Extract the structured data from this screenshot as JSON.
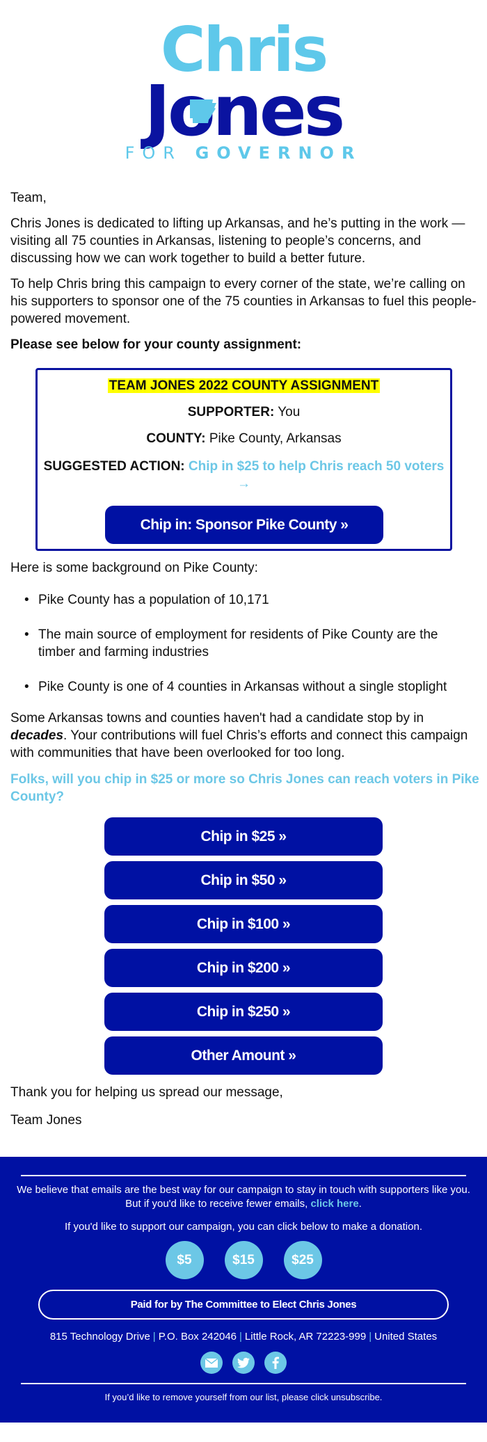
{
  "logo": {
    "first_name": "Chris",
    "last_name": "Jones",
    "tagline_light": "FOR ",
    "tagline_bold": "GOVERNOR",
    "icon": "arkansas-state-shape"
  },
  "body": {
    "greeting": "Team,",
    "paragraph1": "Chris Jones is dedicated to lifting up Arkansas, and he’s putting in the work — visiting all 75 counties in Arkansas, listening to people’s concerns, and discussing how we can work together to build a better future.",
    "paragraph2": "To help Chris bring this campaign to every corner of the state, we’re calling on his supporters to sponsor one of the 75 counties in Arkansas to fuel this people-powered movement.",
    "assignment_intro": "Please see below for your county assignment:"
  },
  "assignment": {
    "title": "TEAM JONES 2022 COUNTY ASSIGNMENT",
    "supporter_label": "SUPPORTER:",
    "supporter_value": " You",
    "county_label": "COUNTY:",
    "county_value": " Pike County, Arkansas",
    "action_label": "SUGGESTED ACTION:",
    "action_link": "Chip in $25 to help Chris reach 50 voters",
    "action_arrow": "→",
    "button_label": "Chip in: Sponsor Pike County »"
  },
  "background": {
    "intro": "Here is some background on Pike County:",
    "facts": [
      "Pike County has a population of 10,171",
      "The main source of employment for residents of Pike County are the timber and farming industries",
      "Pike County is one of 4 counties in Arkansas without a single stoplight"
    ]
  },
  "appeal": {
    "text_before": "Some Arkansas towns and counties haven't had a candidate stop by in ",
    "emphasis": "decades",
    "text_after": ". Your contributions will fuel Chris’s efforts and connect this campaign with communities that have been overlooked for too long.",
    "ask": "Folks, will you chip in $25 or more so Chris Jones can reach voters in Pike County?"
  },
  "donate_buttons": [
    "Chip in $25 »",
    "Chip in $50 »",
    "Chip in $100 »",
    "Chip in $200 »",
    "Chip in $250 »",
    "Other Amount »"
  ],
  "closing": {
    "thanks": "Thank you for helping us spread our message,",
    "signature": "Team Jones"
  },
  "footer": {
    "email_pref_text": "We believe that emails are the best way for our campaign to stay in touch with supporters like you. But if you'd like to receive fewer emails, ",
    "email_pref_link": "click here",
    "email_pref_end": ".",
    "donate_text": "If you'd like to support our campaign, you can click below to make a donation.",
    "quick_amounts": [
      "$5",
      "$15",
      "$25"
    ],
    "paid_for": "Paid for by The Committee to Elect Chris Jones",
    "address_parts": [
      "815 Technology Drive",
      "P.O. Box 242046",
      "Little Rock, AR 72223-999",
      "United States"
    ],
    "address_separator": "|",
    "social_icons": [
      "email-icon",
      "twitter-icon",
      "facebook-icon"
    ],
    "unsubscribe_text": "If you’d like to remove yourself from our list, please click unsubscribe."
  },
  "colors": {
    "navy": "#0011a3",
    "light_blue": "#6cc7e6",
    "highlight": "#ffff00"
  }
}
